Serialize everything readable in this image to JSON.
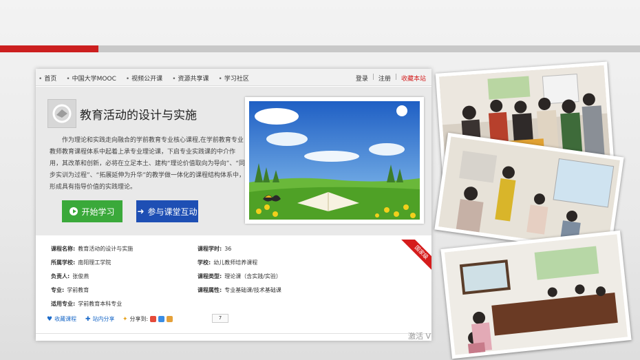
{
  "nav": {
    "left": [
      "首页",
      "中国大学MOOC",
      "视频公开课",
      "资源共享课",
      "学习社区"
    ],
    "login": "登录",
    "register": "注册",
    "favorite": "收藏本站"
  },
  "course": {
    "title": "教育活动的设计与实施",
    "description": "作为理论和实践走向融合的学前教育专业核心课程,在学前教育专业教师教育课程体系中起着上承专业理论课，下启专业实践课的中介作用，其改革和创新，必将在立足本土、建构“理论价值取向为导向”、“同步实训为过程”、“拓展延伸为升华”的教学做一体化的课程结构体系中，形成具有指导价值的实践理论。",
    "btn_start": "开始学习",
    "btn_join": "参与课堂互动",
    "ribbon": "国家级"
  },
  "details": {
    "name_label": "课程名称:",
    "name": "教育活动的设计与实施",
    "school_label": "所属学校:",
    "school": "南阳理工学院",
    "leader_label": "负责人:",
    "leader": "张俊燕",
    "major_label": "专业:",
    "major": "学前教育",
    "applicable_label": "适用专业:",
    "applicable": "学前教育本科专业",
    "hours_label": "课程学时:",
    "hours": "36",
    "college_label": "学校:",
    "college": "幼儿教师培养课程",
    "type_label": "课程类型:",
    "type": "理论课（含实践/实验）",
    "attr_label": "课程属性:",
    "attr": "专业基础课/技术基础课"
  },
  "share": {
    "collect": "收藏课程",
    "site_share": "站内分享",
    "share_to": "分享到:",
    "count": "7"
  },
  "watermark": "激活 V",
  "colors": {
    "accent_red": "#cc1f1f",
    "start_green": "#3aa93a",
    "join_blue": "#1e4fb4"
  }
}
